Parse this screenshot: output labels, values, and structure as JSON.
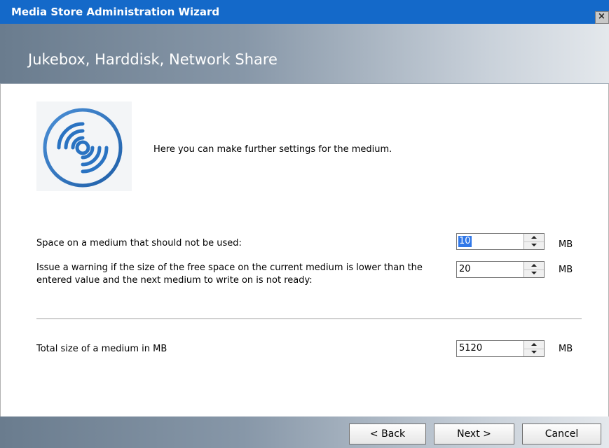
{
  "window": {
    "title": "Media Store Administration Wizard",
    "close_glyph": "×"
  },
  "header": {
    "title": "Jukebox, Harddisk, Network Share"
  },
  "content": {
    "icon": "disc-icon",
    "intro": "Here you can make further settings for the medium.",
    "fields": [
      {
        "label": "Space on a medium that should not be used:",
        "value": "10",
        "unit": "MB"
      },
      {
        "label": "Issue a warning if the size of the free space on the current medium is lower than the entered value and the next medium to write on is not ready:",
        "value": "20",
        "unit": "MB"
      },
      {
        "label": "Total size of a medium in MB",
        "value": "5120",
        "unit": "MB"
      }
    ]
  },
  "buttons": {
    "back": "< Back",
    "next": "Next >",
    "cancel": "Cancel"
  },
  "colors": {
    "titlebar": "#1469c9",
    "selection": "#3178e8",
    "icon_blue": "#2a73c2"
  }
}
